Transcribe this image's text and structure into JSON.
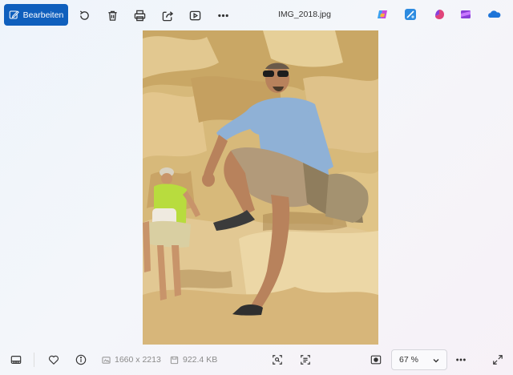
{
  "toolbar": {
    "edit_label": "Bearbeiten",
    "file_name": "IMG_2018.jpg",
    "icons": [
      "edit-icon",
      "rotate-icon",
      "delete-icon",
      "print-icon",
      "share-icon",
      "slideshow-icon",
      "more-icon"
    ],
    "apps": [
      {
        "name": "copilot-icon",
        "color": "#7b5cf0"
      },
      {
        "name": "photo-editor-icon",
        "color": "#2d8be0"
      },
      {
        "name": "clipchamp-icon",
        "color": "#e0447a"
      },
      {
        "name": "designer-icon",
        "color": "#8a3fd8"
      },
      {
        "name": "onedrive-icon",
        "color": "#1d74d8"
      }
    ]
  },
  "status": {
    "dimensions": "1660 x 2213",
    "file_size": "922.4 KB",
    "zoom": "67 %"
  },
  "colors": {
    "accent": "#0f5fbd"
  }
}
